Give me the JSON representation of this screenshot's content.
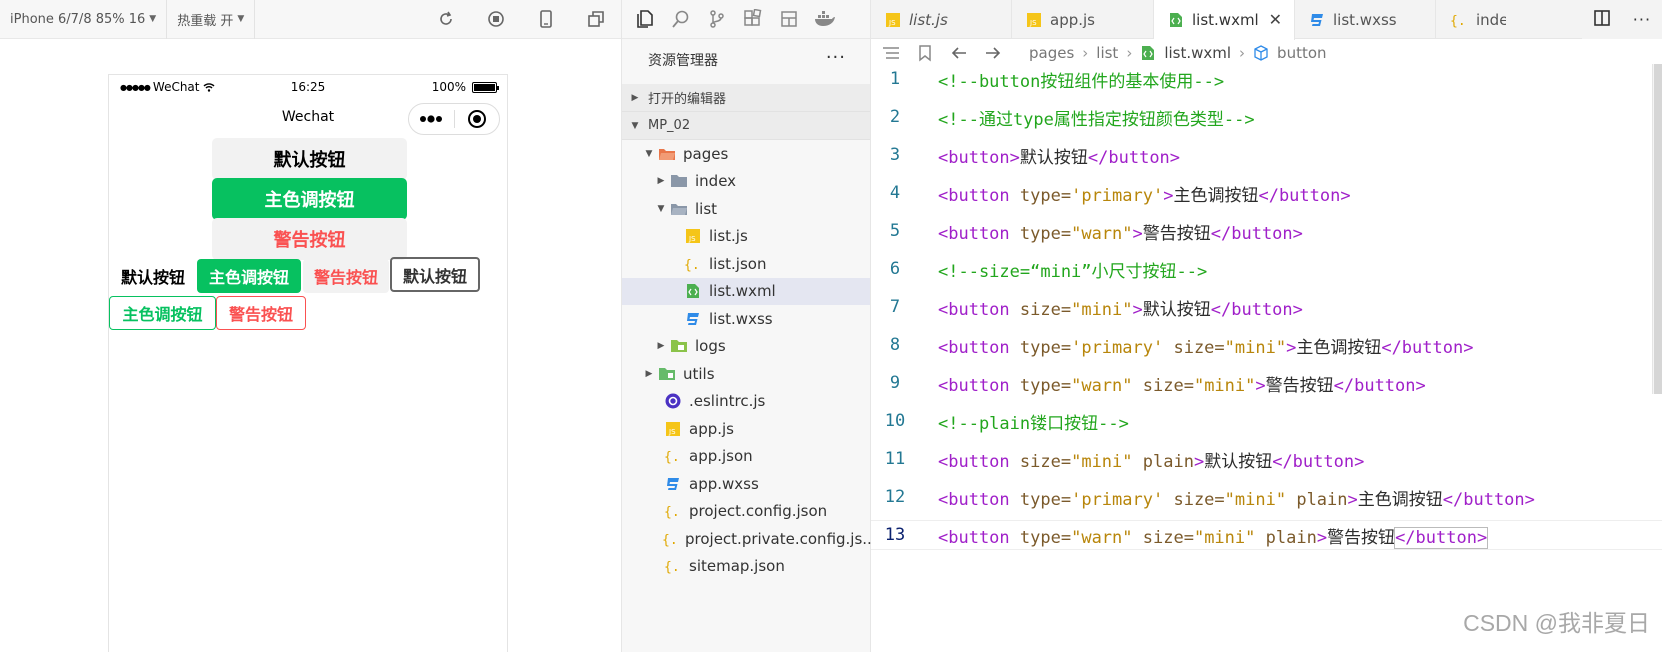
{
  "simulator": {
    "device_label": "iPhone 6/7/8 85% 16",
    "hotreload_label": "热重载 开",
    "status": {
      "carrier": "WeChat",
      "time": "16:25",
      "battery": "100%",
      "battery_level": 1.0
    },
    "nav_title": "Wechat",
    "buttons": {
      "default_big": "默认按钮",
      "primary_big": "主色调按钮",
      "warn_big": "警告按钮",
      "mini_default": "默认按钮",
      "mini_primary": "主色调按钮",
      "mini_warn": "警告按钮",
      "plain_default": "默认按钮",
      "plain_primary": "主色调按钮",
      "plain_warn": "警告按钮"
    }
  },
  "explorer": {
    "title": "资源管理器",
    "more": "···",
    "open_editors": "打开的编辑器",
    "project": "MP_02",
    "tree": {
      "pages": "pages",
      "index": "index",
      "list": "list",
      "list_js": "list.js",
      "list_json": "list.json",
      "list_wxml": "list.wxml",
      "list_wxss": "list.wxss",
      "logs": "logs",
      "utils": "utils",
      "eslintrc": ".eslintrc.js",
      "app_js": "app.js",
      "app_json": "app.json",
      "app_wxss": "app.wxss",
      "project_config": "project.config.json",
      "project_private": "project.private.config.js...",
      "sitemap": "sitemap.json"
    }
  },
  "editor": {
    "tabs": [
      "list.js",
      "app.js",
      "list.wxml",
      "list.wxss",
      "inde"
    ],
    "active_tab": "list.wxml",
    "close": "✕",
    "breadcrumb": [
      "pages",
      "list",
      "list.wxml",
      "button"
    ],
    "line_numbers": [
      "1",
      "2",
      "3",
      "4",
      "5",
      "6",
      "7",
      "8",
      "9",
      "10",
      "11",
      "12",
      "13"
    ],
    "code": {
      "l1": "<!--button按钮组件的基本使用-->",
      "l2": "<!--通过type属性指定按钮颜色类型-->",
      "l6": "<!--size=“mini”小尺寸按钮-->",
      "l10": "<!--plain镂口按钮-->",
      "tag_open": "<button",
      "tag_gt": ">",
      "tag_close": "</button>",
      "attr_type": "type=",
      "attr_size": "size=",
      "attr_plain": "plain",
      "val_primary_sq": "'primary'",
      "val_warn": "\"warn\"",
      "val_mini": "\"mini\"",
      "txt_default": "默认按钮",
      "txt_primary": "主色调按钮",
      "txt_warn": "警告按钮"
    }
  },
  "watermark": "CSDN @我非夏日",
  "colors": {
    "primary": "#07c160",
    "warn": "#fa5151",
    "default_bg": "#f2f2f2",
    "comment": "#22a61d",
    "tag": "#a020c9"
  }
}
